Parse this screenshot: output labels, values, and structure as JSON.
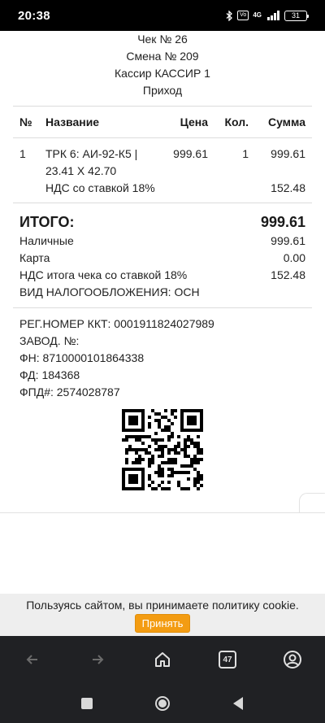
{
  "status_bar": {
    "time": "20:38",
    "battery": "31",
    "network": "4G",
    "icons": [
      "bluetooth-icon",
      "volte-icon",
      "signal-icon",
      "battery-icon"
    ]
  },
  "receipt": {
    "header": [
      "Чек № 26",
      "Смена № 209",
      "Кассир КАССИР 1",
      "Приход"
    ],
    "columns": {
      "no": "№",
      "name": "Название",
      "price": "Цена",
      "qty": "Кол.",
      "sum": "Сумма"
    },
    "items": [
      {
        "no": "1",
        "name": "ТРК 6: АИ-92-К5 | 23.41 X 42.70",
        "price": "999.61",
        "qty": "1",
        "sum": "999.61"
      }
    ],
    "item_vat": {
      "label": "НДС со ставкой 18%",
      "value": "152.48"
    },
    "total": {
      "label": "ИТОГО:",
      "value": "999.61"
    },
    "payments": [
      {
        "label": "Наличные",
        "value": "999.61"
      },
      {
        "label": "Карта",
        "value": "0.00"
      },
      {
        "label": "НДС итога чека со ставкой 18%",
        "value": "152.48"
      }
    ],
    "tax_system": "ВИД НАЛОГООБЛОЖЕНИЯ: ОСН",
    "kkt": [
      "РЕГ.НОМЕР ККТ: 0001911824027989",
      "ЗАВОД. №:",
      "ФН: 8710000101864338",
      "ФД: 184368",
      "ФПД#: 2574028787"
    ]
  },
  "cookie": {
    "text": "Пользуясь сайтом, вы принимаете политику cookie.",
    "accept_label": "Принять",
    "accent_color": "#f39c12"
  },
  "browser": {
    "tabs_count": "47"
  }
}
